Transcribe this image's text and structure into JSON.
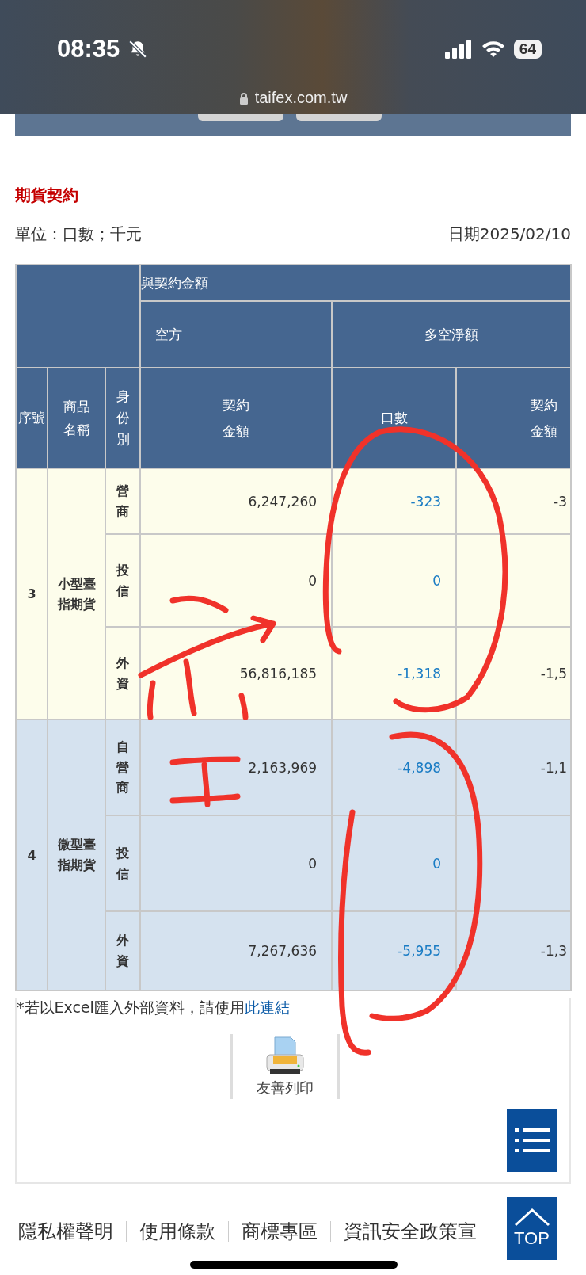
{
  "status_bar": {
    "time": "08:35",
    "battery": "64"
  },
  "browser": {
    "url": "taifex.com.tw"
  },
  "section_title": "期貨契約",
  "unit": "單位：口數；千元",
  "date": "日期2025/02/10",
  "table": {
    "group_header": "與契約金額",
    "subheaders": [
      "空方",
      "多空淨額"
    ],
    "columns": [
      "序號",
      "商品名稱",
      "身份別",
      "契約金額",
      "口數",
      "契約金額"
    ],
    "groups": [
      {
        "number": "3",
        "product": "小型臺指期貨",
        "rows": [
          {
            "identity": "營商",
            "short_amount": "6,247,260",
            "net_contracts": "-323",
            "net_amount": "-3"
          },
          {
            "identity": "投信",
            "short_amount": "0",
            "net_contracts": "0",
            "net_amount": ""
          },
          {
            "identity": "外資",
            "short_amount": "56,816,185",
            "net_contracts": "-1,318",
            "net_amount": "-1,5"
          }
        ]
      },
      {
        "number": "4",
        "product": "微型臺指期貨",
        "rows": [
          {
            "identity": "自營商",
            "short_amount": "2,163,969",
            "net_contracts": "-4,898",
            "net_amount": "-1,1"
          },
          {
            "identity": "投信",
            "short_amount": "0",
            "net_contracts": "0",
            "net_amount": ""
          },
          {
            "identity": "外資",
            "short_amount": "7,267,636",
            "net_contracts": "-5,955",
            "net_amount": "-1,3"
          }
        ]
      }
    ]
  },
  "footnote": {
    "text": "*若以Excel匯入外部資料，請使用",
    "link": "此連結"
  },
  "print_button": "友善列印",
  "top_button": "TOP",
  "footer_links": [
    [
      "隱私權聲明",
      "使用條款",
      "商標專區",
      "資訊安全政策宣"
    ]
  ]
}
